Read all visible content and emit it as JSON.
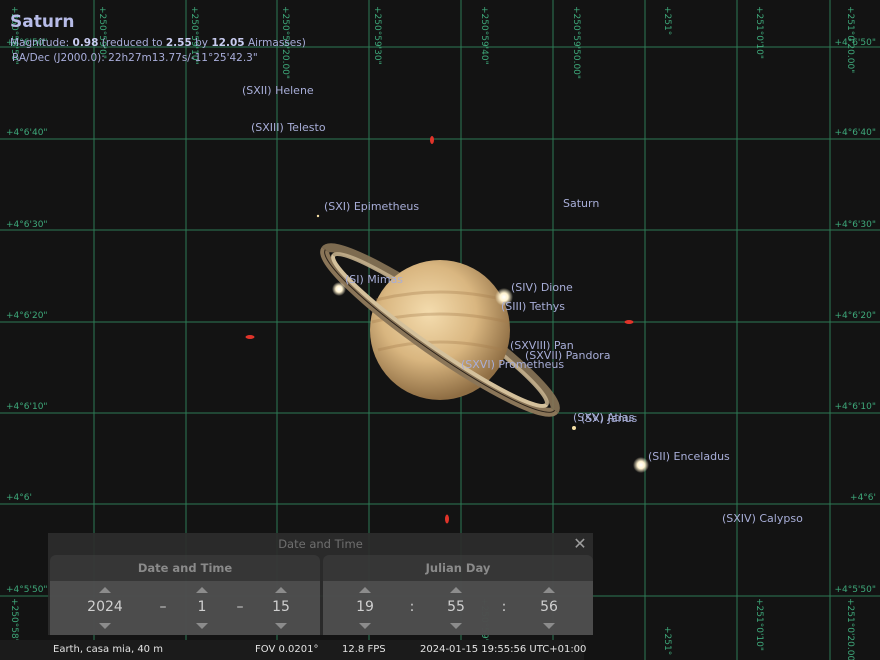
{
  "object": {
    "name": "Saturn",
    "magnitude_label": "Magnitude:",
    "magnitude": "0.98",
    "reduced_text": "(reduced to",
    "reduced": "2.55",
    "by_text": "by",
    "airmasses": "12.05",
    "airmasses_text": "Airmasses)",
    "radec": "RA/Dec (J2000.0): 22h27m13.77s/-11°25'42.3\""
  },
  "grid": {
    "dec_labels": [
      "+4°6'50\"",
      "+4°6'40\"",
      "+4°6'30\"",
      "+4°6'20\"",
      "+4°6'10\"",
      "+4°6'",
      "+4°5'50\""
    ],
    "ra_labels": [
      "+250°58'50\"",
      "+250°59'0\"",
      "+250°59'10\"",
      "+250°59'20.00\"",
      "+250°59'30\"",
      "+250°59'40\"",
      "+250°59'50.00\"",
      "+251°",
      "+251°0'10\"",
      "+251°0'20.00\""
    ]
  },
  "moons": [
    {
      "label": "(SXII) Helene"
    },
    {
      "label": "(SXIII) Telesto"
    },
    {
      "label": "(SXI) Epimetheus"
    },
    {
      "label": "Saturn"
    },
    {
      "label": "(SI) Mimas"
    },
    {
      "label": "(SIV) Dione"
    },
    {
      "label": "(SIII) Tethys"
    },
    {
      "label": "(SXVIII) Pan"
    },
    {
      "label": "(SXVII) Pandora"
    },
    {
      "label": "(SXVI) Prometheus"
    },
    {
      "label": "(SXV) Atlas"
    },
    {
      "label": "(SX) Janus"
    },
    {
      "label": "(SII) Enceladus"
    },
    {
      "label": "(SXIV) Calypso"
    }
  ],
  "dialog": {
    "title": "Date and Time",
    "left_tab": "Date and Time",
    "right_tab": "Julian Day",
    "year": "2024",
    "month": "1",
    "day": "15",
    "hour": "19",
    "minute": "55",
    "second": "56",
    "date_sep": "–",
    "time_sep": ":",
    "close_glyph": "✕"
  },
  "status": {
    "location": "Earth, casa mia, 40 m",
    "fov": "FOV 0.0201°",
    "fps": "12.8 FPS",
    "datetime": "2024-01-15 19:55:56 UTC+01:00"
  },
  "colors": {
    "grid": "#2c7a55",
    "grid_label": "#3ea87a",
    "label": "#a8aed8",
    "star_red": "#e0342a"
  }
}
